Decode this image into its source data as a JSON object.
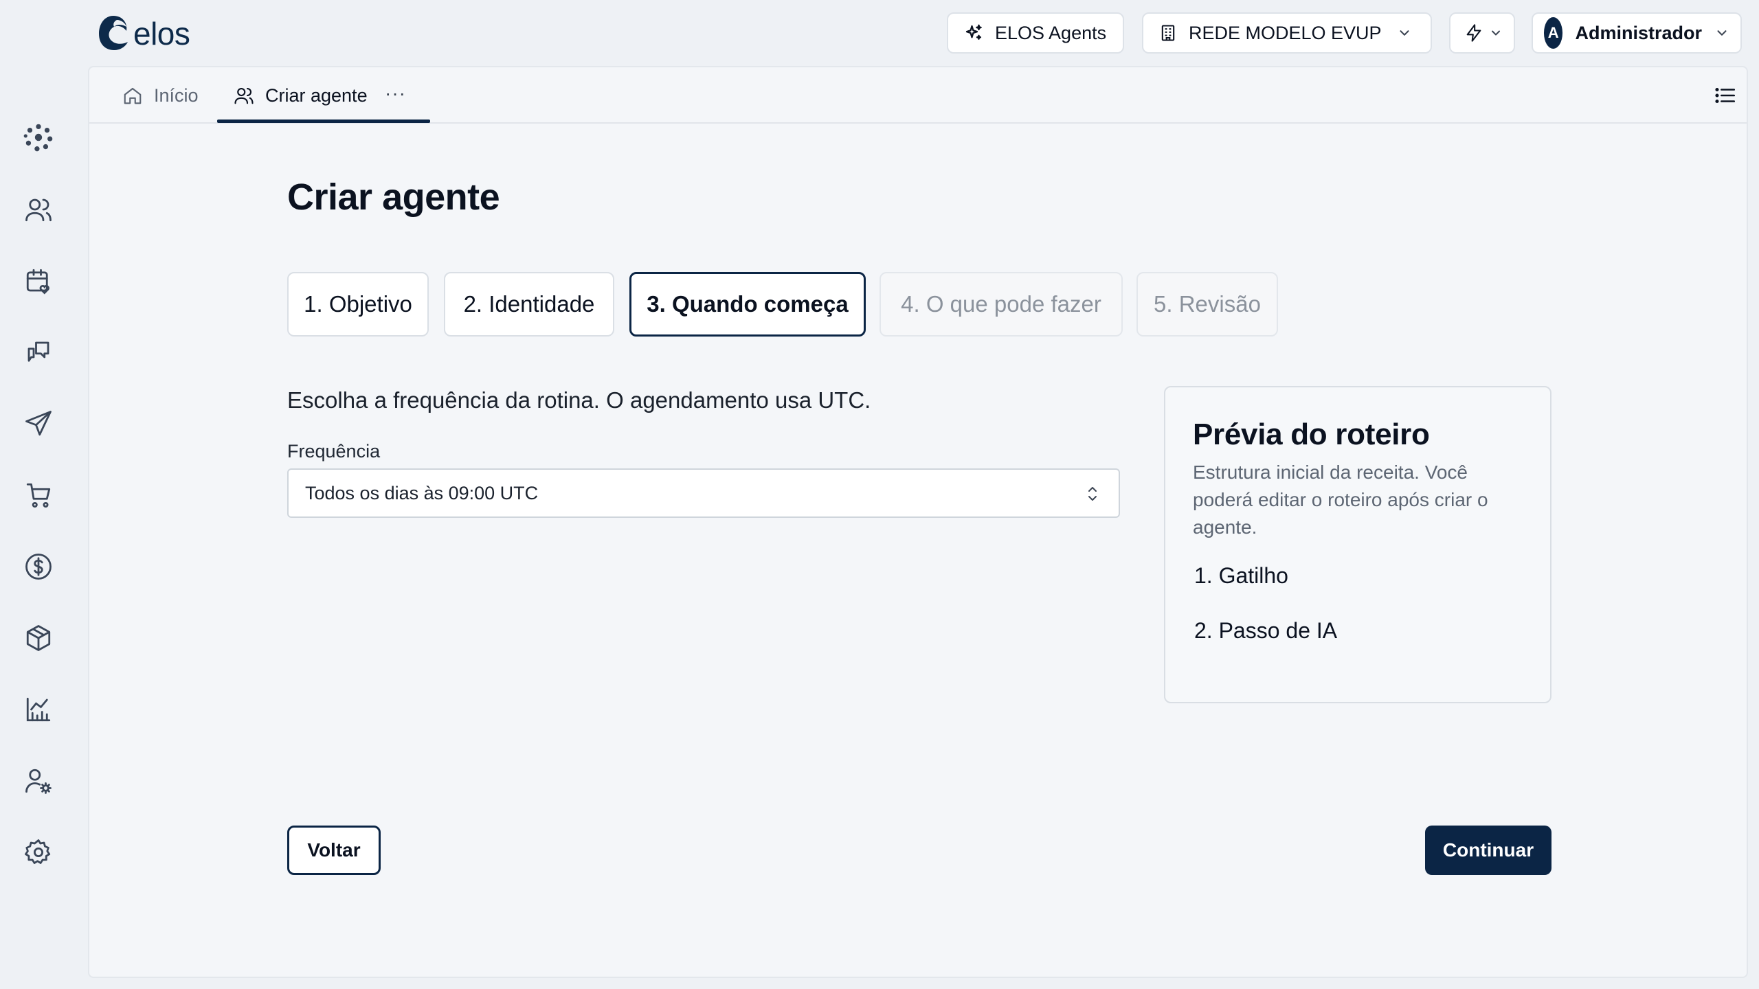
{
  "brand": {
    "name": "elos",
    "color": "#0d2a4a"
  },
  "topbar": {
    "agents_label": "ELOS Agents",
    "network_label": "REDE MODELO EVUP",
    "user": {
      "initial": "A",
      "name": "Administrador"
    }
  },
  "sidebar": {
    "items": [
      {
        "icon": "network-dots-icon"
      },
      {
        "icon": "users-icon"
      },
      {
        "icon": "calendar-heart-icon"
      },
      {
        "icon": "chat-icon"
      },
      {
        "icon": "send-icon"
      },
      {
        "icon": "cart-icon"
      },
      {
        "icon": "dollar-icon"
      },
      {
        "icon": "package-icon"
      },
      {
        "icon": "chart-icon"
      },
      {
        "icon": "user-settings-icon"
      },
      {
        "icon": "gear-icon"
      }
    ]
  },
  "tabs": [
    {
      "label": "Início",
      "icon": "home-icon",
      "active": false
    },
    {
      "label": "Criar agente",
      "icon": "users-icon",
      "active": true
    }
  ],
  "tabs_more": "···",
  "page": {
    "title": "Criar agente",
    "steps": [
      {
        "label": "1. Objetivo",
        "state": "done"
      },
      {
        "label": "2. Identidade",
        "state": "done"
      },
      {
        "label": "3. Quando começa",
        "state": "active"
      },
      {
        "label": "4. O que pode fazer",
        "state": "disabled"
      },
      {
        "label": "5. Revisão",
        "state": "disabled"
      }
    ],
    "description": "Escolha a frequência da rotina. O agendamento usa UTC.",
    "frequency": {
      "label": "Frequência",
      "value": "Todos os dias às 09:00 UTC"
    },
    "preview": {
      "title": "Prévia do roteiro",
      "subtitle": "Estrutura inicial da receita. Você poderá editar o roteiro após criar o agente.",
      "steps": [
        "1. Gatilho",
        "2. Passo de IA"
      ]
    },
    "back_label": "Voltar",
    "continue_label": "Continuar"
  },
  "colors": {
    "primary": "#0b2545",
    "background": "#eef1f5",
    "panel": "#f4f6f9",
    "muted_text": "#5d6673"
  }
}
